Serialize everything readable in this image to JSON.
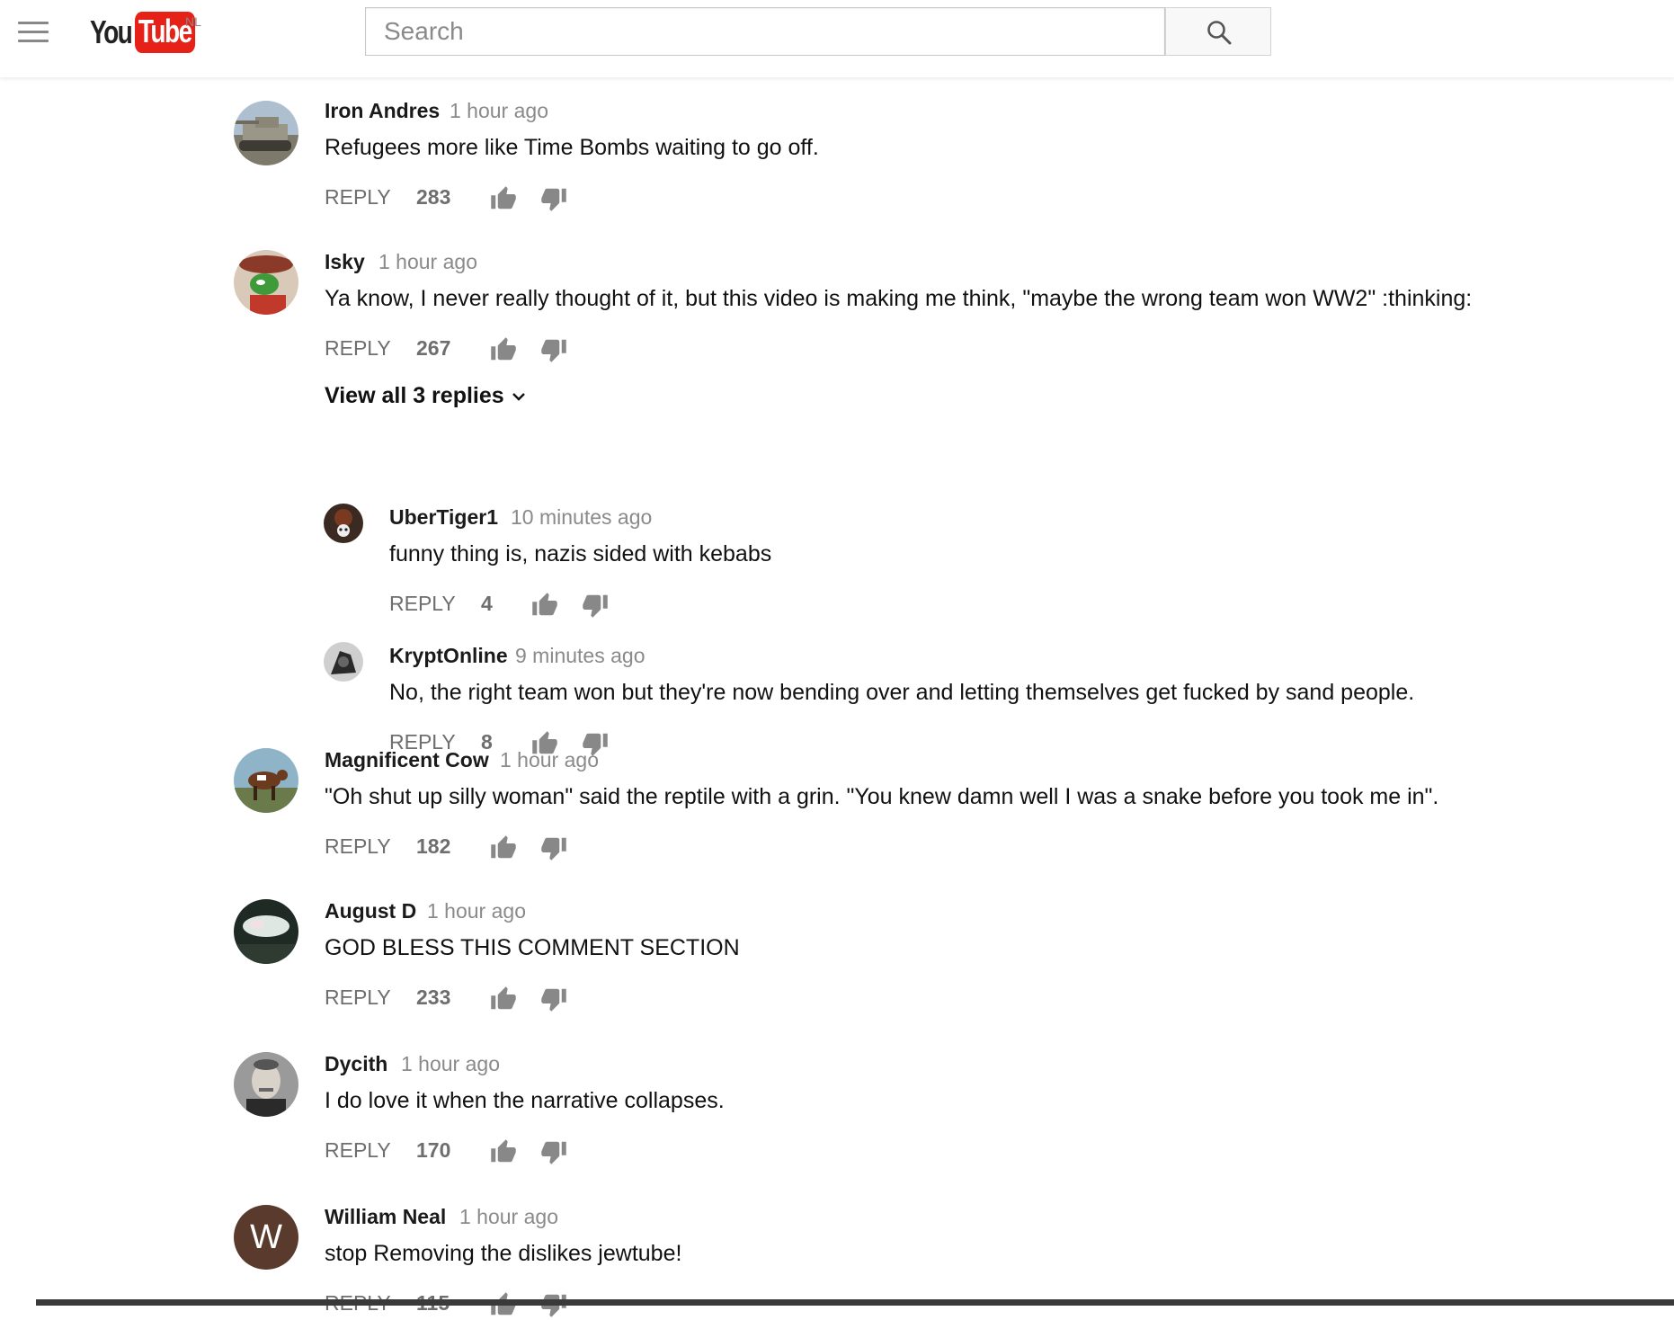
{
  "header": {
    "logo_you": "You",
    "logo_tube": "Tube",
    "country": "NL",
    "search_placeholder": "Search"
  },
  "comments": [
    {
      "author": "Iron Andres",
      "time": "1 hour ago",
      "text": "Refugees more like Time Bombs waiting to go off.",
      "reply": "REPLY",
      "likes": "283"
    },
    {
      "author": "Isky",
      "time": "1 hour ago",
      "text": "Ya know, I never really thought of it, but this video is making me think, \"maybe the wrong team won WW2\" :thinking:",
      "reply": "REPLY",
      "likes": "267",
      "view_replies": "View all 3 replies",
      "replies": [
        {
          "author": "UberTiger1",
          "time": "10 minutes ago",
          "text": "funny thing is, nazis sided with kebabs",
          "reply": "REPLY",
          "likes": "4"
        },
        {
          "author": "KryptOnline",
          "time": "9 minutes ago",
          "text": "No, the right team won but they're now bending over and letting themselves get fucked by sand people.",
          "reply": "REPLY",
          "likes": "8"
        }
      ]
    },
    {
      "author": "Magnificent Cow",
      "time": "1 hour ago",
      "text": "\"Oh shut up silly woman\" said the reptile with a grin. \"You knew damn well I was a snake before you took me in\".",
      "reply": "REPLY",
      "likes": "182"
    },
    {
      "author": "August D",
      "time": "1 hour ago",
      "text": "GOD BLESS THIS COMMENT SECTION",
      "reply": "REPLY",
      "likes": "233"
    },
    {
      "author": "Dycith",
      "time": "1 hour ago",
      "text": "I do love it when the narrative collapses.",
      "reply": "REPLY",
      "likes": "170"
    },
    {
      "author": "William Neal",
      "time": "1 hour ago",
      "text": "stop Removing the dislikes jewtube!",
      "reply": "REPLY",
      "likes": "115",
      "avatar_letter": "W"
    }
  ]
}
